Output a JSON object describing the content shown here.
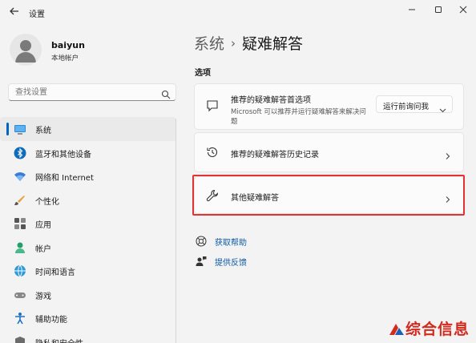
{
  "window": {
    "back_icon": "back-arrow-icon",
    "title": "设置",
    "controls": [
      "minimize-icon",
      "maximize-icon",
      "close-icon"
    ]
  },
  "profile": {
    "name": "baiyun",
    "account_type": "本地帐户"
  },
  "search": {
    "placeholder": "查找设置"
  },
  "sidebar": {
    "items": [
      {
        "label": "系统",
        "icon": "system-icon",
        "active": true
      },
      {
        "label": "蓝牙和其他设备",
        "icon": "bluetooth-icon"
      },
      {
        "label": "网络和 Internet",
        "icon": "wifi-icon"
      },
      {
        "label": "个性化",
        "icon": "brush-icon"
      },
      {
        "label": "应用",
        "icon": "apps-icon"
      },
      {
        "label": "帐户",
        "icon": "account-icon"
      },
      {
        "label": "时间和语言",
        "icon": "globe-icon"
      },
      {
        "label": "游戏",
        "icon": "gamepad-icon"
      },
      {
        "label": "辅助功能",
        "icon": "accessibility-icon"
      },
      {
        "label": "隐私和安全性",
        "icon": "shield-icon"
      }
    ]
  },
  "breadcrumb": {
    "parent": "系统",
    "separator": "›",
    "current": "疑难解答"
  },
  "options": {
    "section_label": "选项",
    "recommended": {
      "title": "推荐的疑难解答首选项",
      "description": "Microsoft 可以推荐并运行疑难解答来解决问题",
      "dropdown_value": "运行前询问我"
    },
    "history": {
      "title": "推荐的疑难解答历史记录"
    },
    "other": {
      "title": "其他疑难解答"
    }
  },
  "help_links": [
    {
      "label": "获取帮助",
      "icon": "help-icon"
    },
    {
      "label": "提供反馈",
      "icon": "feedback-icon"
    }
  ],
  "watermark": {
    "text": "综合信息"
  },
  "colors": {
    "accent": "#0067c0",
    "highlight_border": "#e13333",
    "link": "#0e5aa7",
    "watermark": "#d42a1e"
  }
}
